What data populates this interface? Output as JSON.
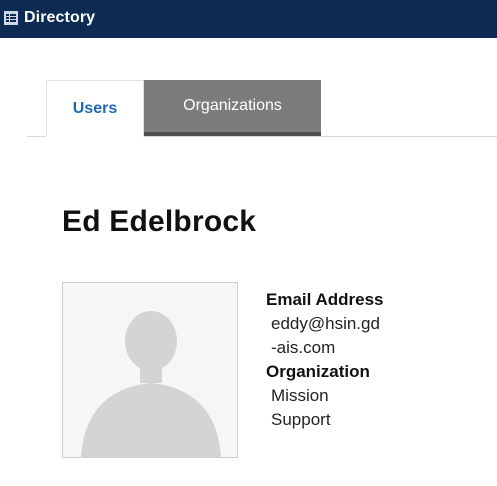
{
  "window": {
    "title": "Directory",
    "icon": "directory-list-icon"
  },
  "tabs": [
    {
      "label": "Users",
      "active": true
    },
    {
      "label": "Organizations",
      "active": false
    }
  ],
  "user": {
    "name": "Ed Edelbrock",
    "avatar_icon": "default-person-silhouette-icon",
    "fields": {
      "email_label": "Email Address",
      "email_line1": "eddy@hsin.gd",
      "email_line2": "-ais.com",
      "organization_label": "Organization",
      "organization_line1": "Mission",
      "organization_line2": "Support"
    }
  },
  "colors": {
    "titlebar_bg": "#0c2a52",
    "active_tab_text": "#2169b5",
    "inactive_tab_bg": "#7c7c7c"
  }
}
